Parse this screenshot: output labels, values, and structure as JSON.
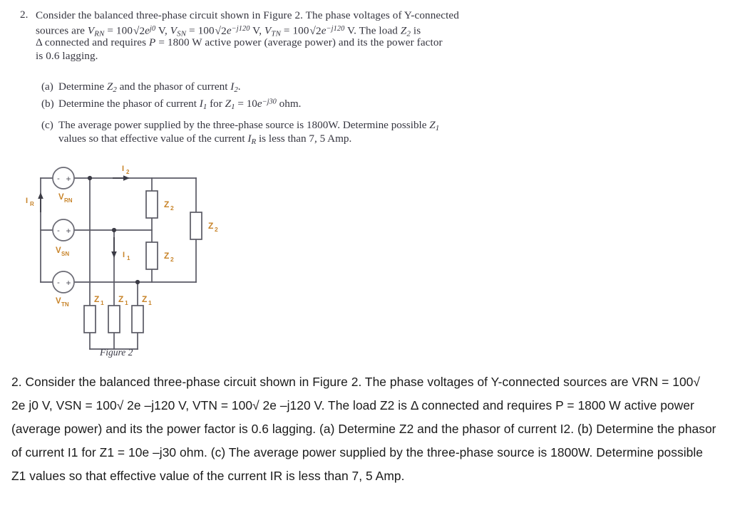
{
  "document": {
    "problem_number": "2.",
    "scanned_problem": {
      "line1": "Consider the balanced three-phase circuit shown in Figure 2. The phase voltages of Y-connected",
      "line2_prefix": "sources are ",
      "line2_vrn": "V",
      "line2_vrn_sub": "RN",
      "line2_eq1": " = 100",
      "line2_rad1": "√2",
      "line2_e1": "e",
      "line2_exp1": "j0",
      "line2_v1": " V, ",
      "line2_vsn": "V",
      "line2_vsn_sub": "SN",
      "line2_eq2": " = 100",
      "line2_rad2": "√2",
      "line2_e2": "e",
      "line2_exp2": "−j120",
      "line2_v2": " V, ",
      "line2_vtn": "V",
      "line2_vtn_sub": "TN",
      "line2_eq3": " = 100",
      "line2_rad3": "√2",
      "line2_e3": "e",
      "line2_exp3": "−j120",
      "line2_v3": " V. The load ",
      "line2_z2": "Z",
      "line2_z2_sub": "2",
      "line2_tail": " is",
      "line3_delta": "Δ",
      "line3_a": " connected and requires ",
      "line3_p": "P",
      "line3_b": " = 1800 W active power (average power) and its the power factor",
      "line4": "is 0.6 lagging."
    },
    "subquestions": [
      {
        "label": "(a)",
        "text_a": "Determine ",
        "sym1": "Z",
        "sym1_sub": "2",
        "text_b": " and the phasor of current ",
        "sym2": "I",
        "sym2_sub": "2",
        "text_c": "."
      },
      {
        "label": "(b)",
        "text_a": "Determine the phasor of current ",
        "sym1": "I",
        "sym1_sub": "1",
        "text_b": " for ",
        "sym2": "Z",
        "sym2_sub": "1",
        "text_c": " = 10",
        "e": "e",
        "exp": "−j30",
        "text_d": " ohm."
      },
      {
        "label": "(c)",
        "line1_a": "The average power supplied by the three-phase source is 1800W. Determine possible ",
        "line1_sym": "Z",
        "line1_sym_sub": "1",
        "line2_a": "values so that effective value of the current ",
        "line2_sym": "I",
        "line2_sym_sub": "R",
        "line2_b": " is less than 7, 5 Amp."
      }
    ],
    "figure": {
      "caption": "Figure 2",
      "current_labels": {
        "ir": "I",
        "ir_sub": "R",
        "i1": "I",
        "i1_sub": "1",
        "i2": "I",
        "i2_sub": "2"
      },
      "sources": [
        {
          "name": "V",
          "sub": "RN",
          "minus": "-",
          "plus": "+"
        },
        {
          "name": "V",
          "sub": "SN",
          "minus": "-",
          "plus": "+"
        },
        {
          "name": "V",
          "sub": "TN",
          "minus": "-",
          "plus": "+"
        }
      ],
      "impedances_z2": [
        {
          "name": "Z",
          "sub": "2"
        },
        {
          "name": "Z",
          "sub": "2"
        },
        {
          "name": "Z",
          "sub": "2"
        }
      ],
      "impedances_z1": [
        {
          "name": "Z",
          "sub": "1"
        },
        {
          "name": "Z",
          "sub": "1"
        },
        {
          "name": "Z",
          "sub": "1"
        }
      ],
      "colors": {
        "wire": "#5a5a64",
        "label": "#c8842a",
        "source_outline": "#6b6b75"
      }
    },
    "transcription": {
      "paragraph": "2. Consider the balanced three-phase circuit shown in Figure 2. The phase voltages of Y-connected sources are VRN = 100√ 2e j0 V, VSN = 100√ 2e –j120 V, VTN = 100√ 2e –j120 V. The load Z2 is Δ connected and requires P = 1800 W active power (average power) and its the power factor is 0.6 lagging. (a) Determine Z2 and the phasor of current I2. (b) Determine the phasor of current I1 for Z1 = 10e –j30 ohm. (c) The average power supplied by the three-phase source is 1800W. Determine possible Z1 values so that effective value of the current IR is less than 7, 5 Amp."
    }
  }
}
